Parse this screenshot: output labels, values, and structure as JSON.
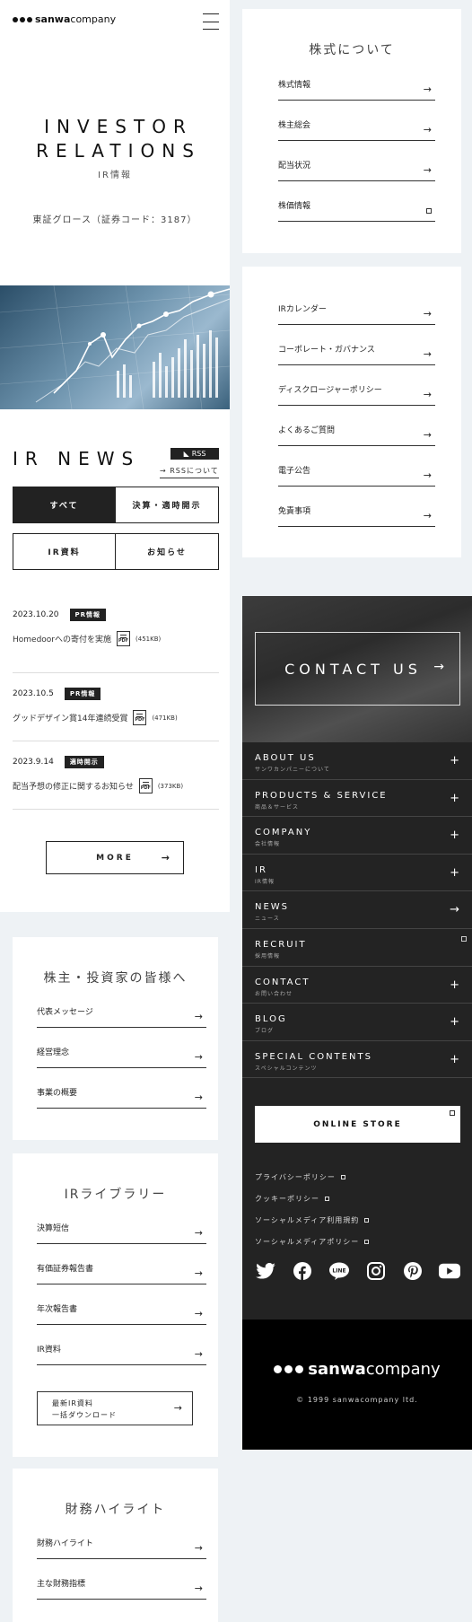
{
  "header": {
    "logo_bold": "sanwa",
    "logo_light": "company"
  },
  "hero": {
    "title_line1": "INVESTOR",
    "title_line2": "RELATIONS",
    "subtitle": "IR情報",
    "market": "東証グロース（証券コード：3187）"
  },
  "news": {
    "title": "IR NEWS",
    "rss_label": "RSS",
    "rss_about": "RSSについて",
    "tabs": [
      "すべて",
      "決算・適時開示",
      "IR資料",
      "お知らせ"
    ],
    "items": [
      {
        "date": "2023.10.20",
        "badge": "PR情報",
        "text": "Homedoorへの寄付を実施",
        "size": "(451KB)"
      },
      {
        "date": "2023.10.5",
        "badge": "PR情報",
        "text": "グッドデザイン賞14年連続受賞",
        "size": "(471KB)"
      },
      {
        "date": "2023.9.14",
        "badge": "適時開示",
        "text": "配当予想の修正に関するお知らせ",
        "size": "(373KB)"
      }
    ],
    "more_label": "MORE"
  },
  "shareholders": {
    "title": "株主・投資家の皆様へ",
    "links": [
      "代表メッセージ",
      "経営理念",
      "事業の概要"
    ]
  },
  "library": {
    "title": "IRライブラリー",
    "links": [
      "決算短信",
      "有価証券報告書",
      "年次報告書",
      "IR資料"
    ],
    "download_line1": "最新IR資料",
    "download_line2": "一括ダウンロード"
  },
  "financial": {
    "title": "財務ハイライト",
    "links": [
      "財務ハイライト",
      "主な財務指標"
    ]
  },
  "stock": {
    "title": "株式について",
    "links": [
      "株式情報",
      "株主総会",
      "配当状況",
      "株価情報"
    ]
  },
  "ir_links": [
    "IRカレンダー",
    "コーポレート・ガバナンス",
    "ディスクロージャーポリシー",
    "よくあるご質問",
    "電子公告",
    "免責事項"
  ],
  "contact": {
    "label": "CONTACT US"
  },
  "menu": [
    {
      "en": "ABOUT US",
      "jp": "サンワカンパニーについて",
      "icon": "plus-icon"
    },
    {
      "en": "PRODUCTS & SERVICE",
      "jp": "商品＆サービス",
      "icon": "plus-icon"
    },
    {
      "en": "COMPANY",
      "jp": "会社情報",
      "icon": "plus-icon"
    },
    {
      "en": "IR",
      "jp": "IR情報",
      "icon": "plus-icon"
    },
    {
      "en": "NEWS",
      "jp": "ニュース",
      "icon": "arrow-right-icon"
    },
    {
      "en": "RECRUIT",
      "jp": "採用情報",
      "icon": "external-link-icon"
    },
    {
      "en": "CONTACT",
      "jp": "お問い合わせ",
      "icon": "plus-icon"
    },
    {
      "en": "BLOG",
      "jp": "ブログ",
      "icon": "plus-icon"
    },
    {
      "en": "SPECIAL CONTENTS",
      "jp": "スペシャルコンテンツ",
      "icon": "plus-icon"
    }
  ],
  "store_label": "ONLINE STORE",
  "policies": [
    "プライバシーポリシー",
    "クッキーポリシー",
    "ソーシャルメディア利用規約",
    "ソーシャルメディアポリシー"
  ],
  "social_icons": [
    "twitter-icon",
    "facebook-icon",
    "line-icon",
    "instagram-icon",
    "pinterest-icon",
    "youtube-icon"
  ],
  "footer": {
    "logo_bold": "sanwa",
    "logo_light": "company",
    "copyright": "© 1999 sanwacompany ltd."
  }
}
